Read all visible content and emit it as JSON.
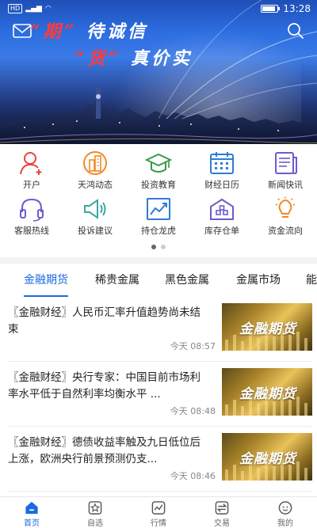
{
  "status_bar": {
    "left": "HD 4G",
    "time": "13:28"
  },
  "banner": {
    "slogan_line1": [
      "“",
      "期",
      "”",
      " 待诚信"
    ],
    "slogan_line2": [
      "“",
      "货",
      "”",
      " 真价实"
    ]
  },
  "grid": [
    {
      "label": "开户",
      "icon": "user-add-icon"
    },
    {
      "label": "天鸿动态",
      "icon": "buildings-icon"
    },
    {
      "label": "投资教育",
      "icon": "graduation-cap-icon"
    },
    {
      "label": "财经日历",
      "icon": "calendar-icon"
    },
    {
      "label": "新闻快讯",
      "icon": "newspaper-icon"
    },
    {
      "label": "客服热线",
      "icon": "headset-icon"
    },
    {
      "label": "投诉建议",
      "icon": "megaphone-icon"
    },
    {
      "label": "持仓龙虎",
      "icon": "trend-chart-icon"
    },
    {
      "label": "库存仓单",
      "icon": "warehouse-icon"
    },
    {
      "label": "资金流向",
      "icon": "bulb-icon"
    }
  ],
  "tabs": [
    "金融期货",
    "稀贵金属",
    "黑色金属",
    "金属市场",
    "能"
  ],
  "news": [
    {
      "title": "〖金融财经〗人民币汇率升值趋势尚未结束",
      "time": "今天 08:57",
      "thumb_text": "金融期货"
    },
    {
      "title": "〖金融财经〗央行专家：中国目前市场利率水平低于自然利率均衡水平 ...",
      "time": "今天 08:48",
      "thumb_text": "金融期货"
    },
    {
      "title": "〖金融财经〗德债收益率触及九日低位后上涨，欧洲央行前景预测仍支...",
      "time": "今天 08:46",
      "thumb_text": "金融期货"
    }
  ],
  "bottom_nav": [
    {
      "label": "首页",
      "icon": "home-icon",
      "active": true
    },
    {
      "label": "自选",
      "icon": "favorites-icon"
    },
    {
      "label": "行情",
      "icon": "market-chart-icon"
    },
    {
      "label": "交易",
      "icon": "trade-icon"
    },
    {
      "label": "我的",
      "icon": "profile-icon"
    }
  ],
  "colors": {
    "accent": "#1a6be0",
    "icon_orange": "#f08a24",
    "icon_blue": "#2f7bd8",
    "icon_green": "#3a9a4a",
    "icon_purple": "#6b5bd0",
    "red": "#e8463a"
  }
}
